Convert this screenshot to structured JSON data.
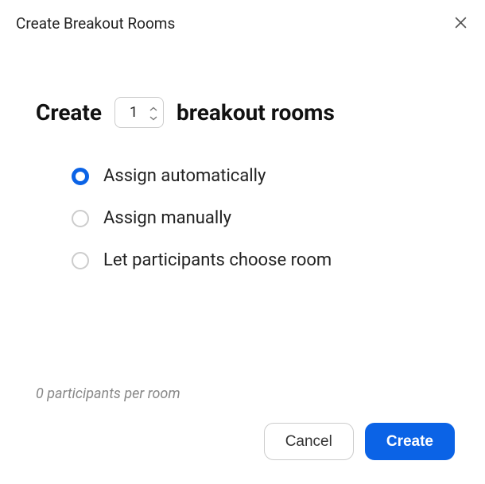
{
  "dialog": {
    "title": "Create Breakout Rooms"
  },
  "create": {
    "prefix": "Create",
    "count": "1",
    "suffix": "breakout rooms"
  },
  "options": [
    {
      "label": "Assign automatically",
      "selected": true
    },
    {
      "label": "Assign manually",
      "selected": false
    },
    {
      "label": "Let participants choose room",
      "selected": false
    }
  ],
  "status": {
    "text": "0 participants per room"
  },
  "buttons": {
    "cancel": "Cancel",
    "create": "Create"
  }
}
